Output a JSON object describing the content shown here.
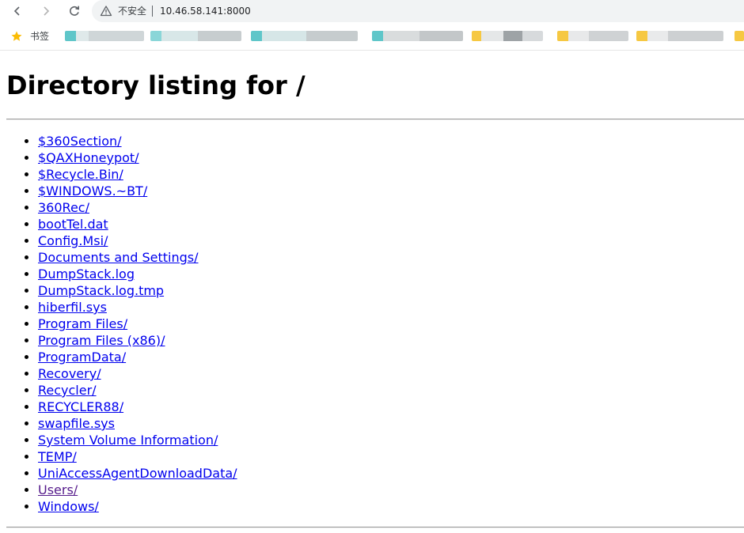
{
  "browser": {
    "security_label": "不安全",
    "url": "10.46.58.141:8000",
    "bookmarks_label": "书签"
  },
  "page": {
    "title": "Directory listing for /",
    "entries": [
      {
        "name": "$360Section/",
        "visited": false
      },
      {
        "name": "$QAXHoneypot/",
        "visited": false
      },
      {
        "name": "$Recycle.Bin/",
        "visited": false
      },
      {
        "name": "$WINDOWS.~BT/",
        "visited": false
      },
      {
        "name": "360Rec/",
        "visited": false
      },
      {
        "name": "bootTel.dat",
        "visited": false
      },
      {
        "name": "Config.Msi/",
        "visited": false
      },
      {
        "name": "Documents and Settings/",
        "visited": false
      },
      {
        "name": "DumpStack.log",
        "visited": false
      },
      {
        "name": "DumpStack.log.tmp",
        "visited": false
      },
      {
        "name": "hiberfil.sys",
        "visited": false
      },
      {
        "name": "Program Files/",
        "visited": false
      },
      {
        "name": "Program Files (x86)/",
        "visited": false
      },
      {
        "name": "ProgramData/",
        "visited": false
      },
      {
        "name": "Recovery/",
        "visited": false
      },
      {
        "name": "Recycler/",
        "visited": false
      },
      {
        "name": "RECYCLER88/",
        "visited": false
      },
      {
        "name": "swapfile.sys",
        "visited": false
      },
      {
        "name": "System Volume Information/",
        "visited": false
      },
      {
        "name": "TEMP/",
        "visited": false
      },
      {
        "name": "UniAccessAgentDownloadData/",
        "visited": false
      },
      {
        "name": "Users/",
        "visited": true
      },
      {
        "name": "Windows/",
        "visited": false
      }
    ]
  },
  "colors": {
    "link": "#0000ee",
    "visited_link": "#551a8b",
    "warning": "#5f6368",
    "bookmark_star": "#fbbc04"
  }
}
